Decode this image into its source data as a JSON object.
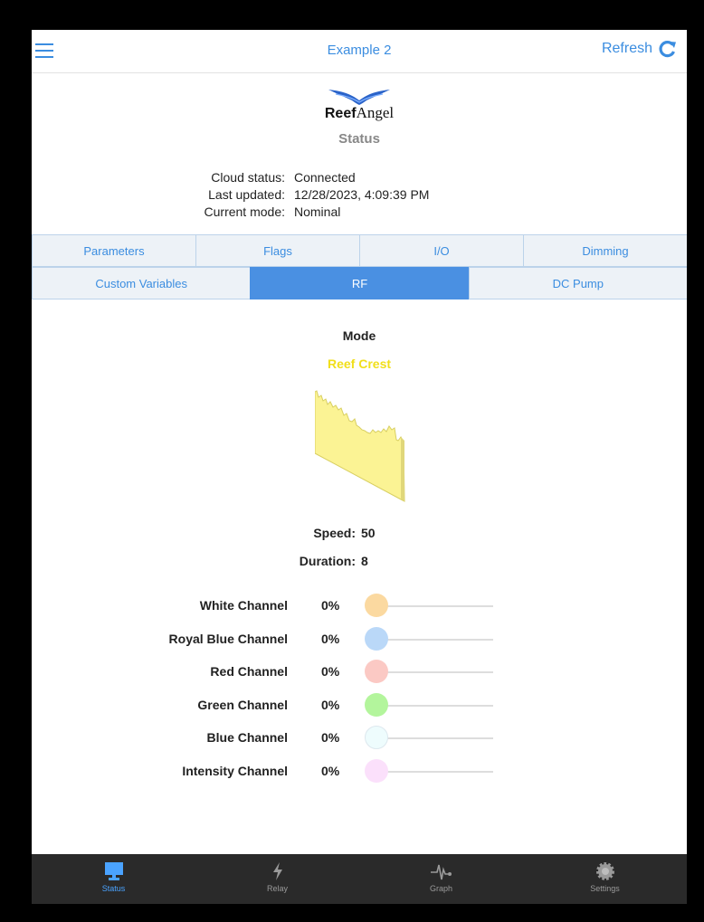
{
  "header": {
    "title": "Example 2",
    "refresh_label": "Refresh"
  },
  "logo": {
    "text_bold": "Reef",
    "text_regular": "Angel"
  },
  "status_heading": "Status",
  "info": [
    {
      "key": "Cloud status:",
      "value": "Connected"
    },
    {
      "key": "Last updated:",
      "value": "12/28/2023, 4:09:39 PM"
    },
    {
      "key": "Current mode:",
      "value": "Nominal"
    }
  ],
  "tabs_row1": [
    "Parameters",
    "Flags",
    "I/O",
    "Dimming"
  ],
  "tabs_row2": [
    "Custom Variables",
    "RF",
    "DC Pump"
  ],
  "active_tab": "RF",
  "rf": {
    "mode_label": "Mode",
    "mode_value": "Reef Crest",
    "mode_color": "#f1df1a",
    "speed_label": "Speed:",
    "speed_value": "50",
    "duration_label": "Duration:",
    "duration_value": "8",
    "channels": [
      {
        "name": "White Channel",
        "value": "0%",
        "color": "#fbd9a0",
        "level": 0
      },
      {
        "name": "Royal Blue Channel",
        "value": "0%",
        "color": "#bad8f8",
        "level": 0
      },
      {
        "name": "Red Channel",
        "value": "0%",
        "color": "#fbc9c4",
        "level": 0
      },
      {
        "name": "Green Channel",
        "value": "0%",
        "color": "#b3f59c",
        "level": 0
      },
      {
        "name": "Blue Channel",
        "value": "0%",
        "color": "#eefcfd",
        "level": 0
      },
      {
        "name": "Intensity Channel",
        "value": "0%",
        "color": "#fbe0fb",
        "level": 0
      }
    ]
  },
  "bottom_nav": [
    {
      "label": "Status",
      "icon": "monitor-icon",
      "active": true
    },
    {
      "label": "Relay",
      "icon": "lightning-icon",
      "active": false
    },
    {
      "label": "Graph",
      "icon": "pulse-icon",
      "active": false
    },
    {
      "label": "Settings",
      "icon": "gear-icon",
      "active": false
    }
  ],
  "colors": {
    "accent": "#3b8de0",
    "tab_active": "#4a90e2",
    "nav_bg": "#2a2a2a"
  }
}
